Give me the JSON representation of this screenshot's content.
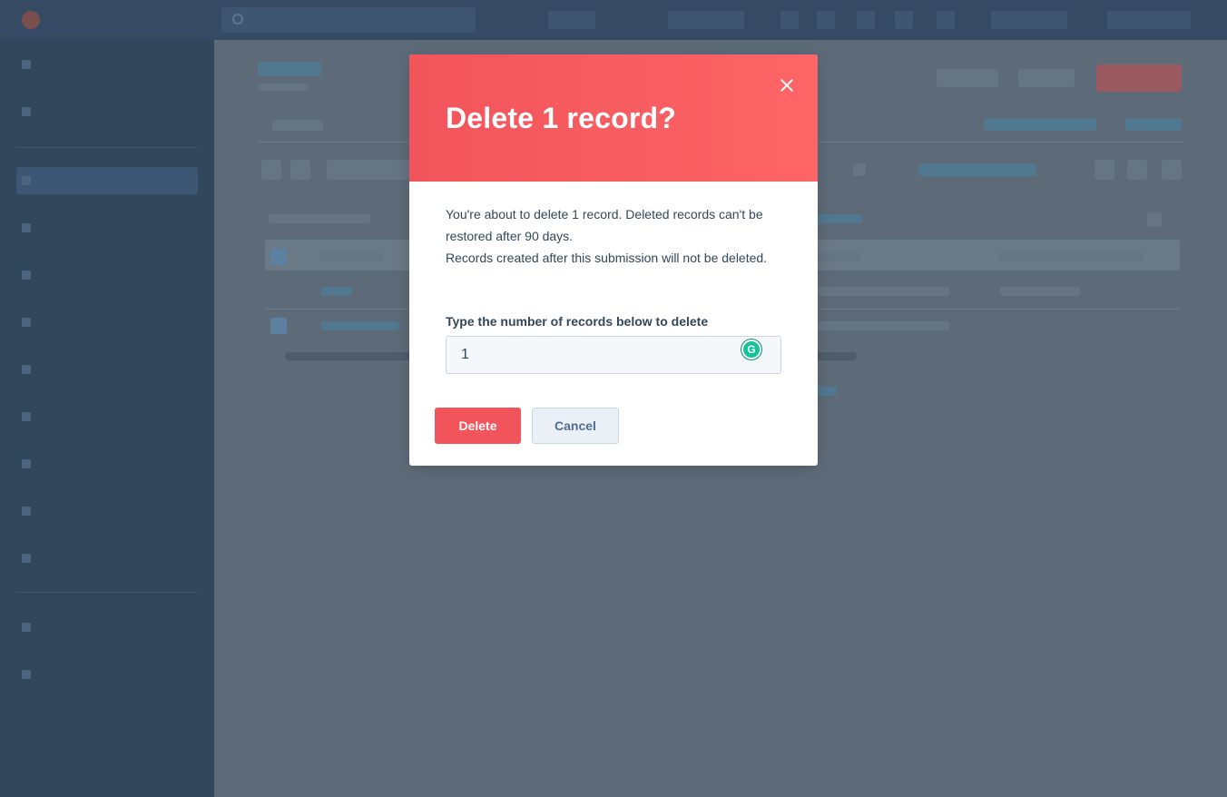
{
  "dialog": {
    "title": "Delete 1 record?",
    "message_line_1": "You're about to delete 1 record. Deleted records can't be restored after 90 days.",
    "message_line_2": "Records created after this submission will not be deleted.",
    "input_label": "Type the number of records below to delete",
    "input_value": "1",
    "delete_label": "Delete",
    "cancel_label": "Cancel",
    "grammarly_glyph": "G"
  },
  "colors": {
    "header_red": "#f2545b",
    "delete_button": "#f2545b",
    "cancel_button_bg": "#eaf0f6",
    "grammarly_green": "#15c39a"
  },
  "icons": {
    "close": "close-icon",
    "grammarly": "grammarly-icon"
  }
}
